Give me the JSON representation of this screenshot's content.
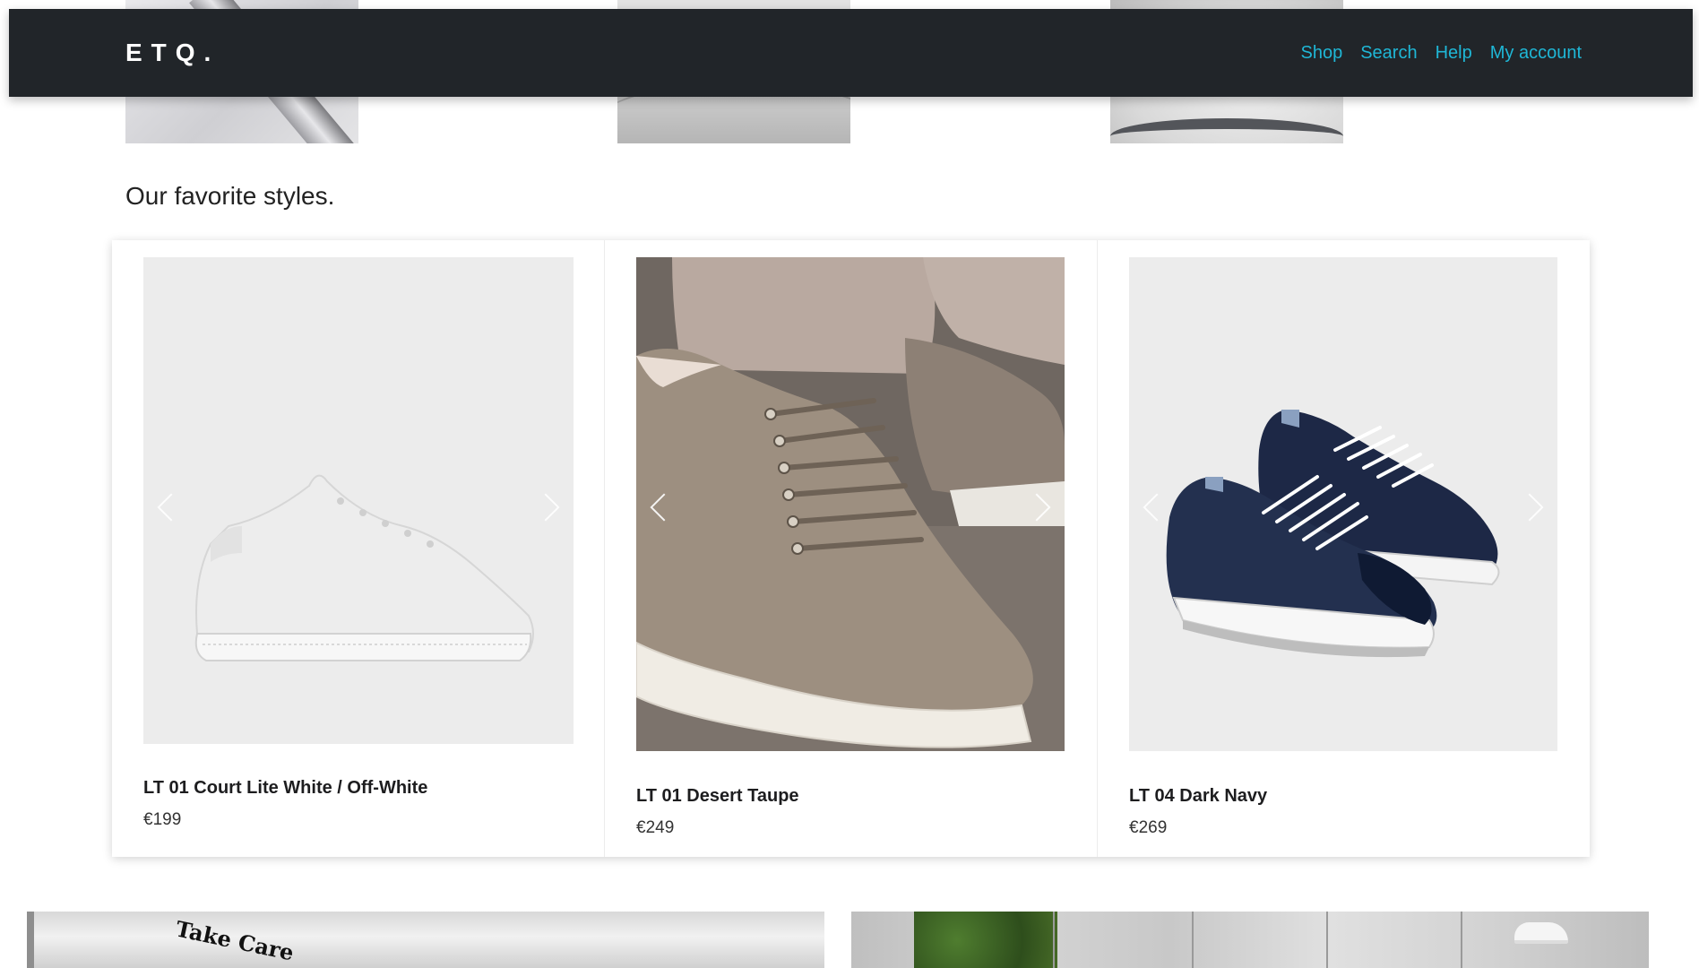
{
  "header": {
    "brand": "ETQ.",
    "nav": [
      "Shop",
      "Search",
      "Help",
      "My account"
    ]
  },
  "section": {
    "title": "Our favorite styles."
  },
  "products": [
    {
      "name": "LT 01 Court Lite White / Off-White",
      "price": "€199",
      "color": "#f2f2f2"
    },
    {
      "name": "LT 01 Desert Taupe",
      "price": "€249",
      "color": "#9e8f7e"
    },
    {
      "name": "LT 04 Dark Navy",
      "price": "€269",
      "color": "#1f2a44"
    }
  ],
  "banner": {
    "text": "Take Care"
  }
}
